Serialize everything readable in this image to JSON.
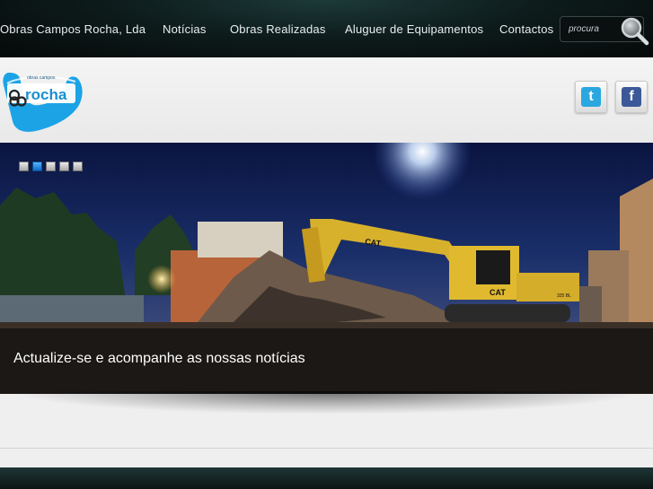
{
  "nav": {
    "items": [
      {
        "label": "Obras Campos Rocha, Lda"
      },
      {
        "label": "Notícias"
      },
      {
        "label": "Obras Realizadas"
      },
      {
        "label": "Aluguer de Equipamentos"
      },
      {
        "label": "Contactos"
      }
    ],
    "search": {
      "placeholder": "procura",
      "value": ""
    }
  },
  "logo": {
    "text": "rocha",
    "tagline": "obras campos"
  },
  "social": {
    "twitter_glyph": "t",
    "facebook_glyph": "f"
  },
  "slider": {
    "caption": "Actualize-se e acompanhe as nossas notícias",
    "slide_count": 5,
    "active_index": 1,
    "machine_brand": "CAT",
    "machine_model": "325 BL"
  },
  "colors": {
    "nav_background": "#0e1c1c",
    "logo_blue": "#1ba3e6",
    "active_dot": "#1a7fe0",
    "twitter": "#2aa7df",
    "facebook": "#3b5998"
  }
}
